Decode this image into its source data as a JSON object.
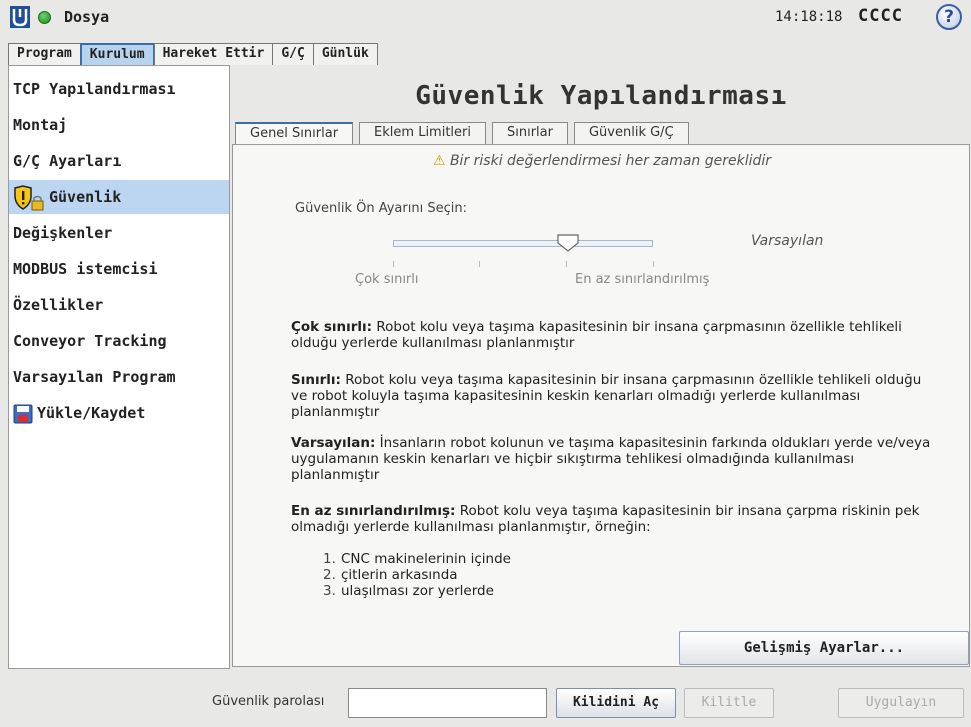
{
  "header": {
    "app_title": "Dosya",
    "clock": "14:18:18",
    "robot_name": "CCCC",
    "help_label": "?"
  },
  "main_tabs": [
    {
      "label": "Program",
      "active": false
    },
    {
      "label": "Kurulum",
      "active": true
    },
    {
      "label": "Hareket Ettir",
      "active": false
    },
    {
      "label": "G/Ç",
      "active": false
    },
    {
      "label": "Günlük",
      "active": false
    }
  ],
  "sidebar": {
    "items": [
      {
        "label": "TCP Yapılandırması"
      },
      {
        "label": "Montaj"
      },
      {
        "label": "G/Ç Ayarları"
      },
      {
        "label": "Güvenlik",
        "icon": "shield-lock-icon",
        "active": true
      },
      {
        "label": "Değişkenler"
      },
      {
        "label": "MODBUS istemcisi"
      },
      {
        "label": "Özellikler"
      },
      {
        "label": "Conveyor Tracking"
      },
      {
        "label": "Varsayılan Program"
      },
      {
        "label": "Yükle/Kaydet",
        "icon": "floppy-disk-icon"
      }
    ]
  },
  "content": {
    "title": "Güvenlik Yapılandırması",
    "sub_tabs": [
      {
        "label": "Genel Sınırlar",
        "active": true
      },
      {
        "label": "Eklem Limitleri",
        "active": false
      },
      {
        "label": "Sınırlar",
        "active": false
      },
      {
        "label": "Güvenlik G/Ç",
        "active": false
      }
    ],
    "warning": "Bir riski değerlendirmesi her zaman gereklidir",
    "preset": {
      "label": "Güvenlik Ön Ayarını Seçin:",
      "value": "Varsayılan",
      "min_label": "Çok sınırlı",
      "max_label": "En az sınırlandırılmış"
    },
    "descriptions": [
      {
        "term": "Çok sınırlı:",
        "text": " Robot kolu veya taşıma kapasitesinin bir insana çarpmasının özellikle tehlikeli olduğu yerlerde kullanılması planlanmıştır"
      },
      {
        "term": "Sınırlı:",
        "text": " Robot kolu veya taşıma kapasitesinin bir insana çarpmasının özellikle tehlikeli olduğu ve robot koluyla taşıma kapasitesinin keskin kenarları olmadığı yerlerde kullanılması planlanmıştır"
      },
      {
        "term": "Varsayılan:",
        "text": " İnsanların robot kolunun ve taşıma kapasitesinin farkında oldukları yerde ve/veya uygulamanın keskin kenarları ve hiçbir sıkıştırma tehlikesi olmadığında kullanılması planlanmıştır"
      },
      {
        "term": "En az sınırlandırılmış:",
        "text": " Robot kolu veya taşıma kapasitesinin bir insana çarpma riskinin pek olmadığı yerlerde kullanılması planlanmıştır, örneğin:"
      }
    ],
    "examples": [
      {
        "num": "1.",
        "text": "CNC makinelerinin içinde"
      },
      {
        "num": "2.",
        "text": "çitlerin arkasında"
      },
      {
        "num": "3.",
        "text": "ulaşılması zor yerlerde"
      }
    ],
    "advanced_button": "Gelişmiş Ayarlar..."
  },
  "footer": {
    "password_label": "Güvenlik parolası",
    "password_value": "",
    "unlock_button": "Kilidini Aç",
    "lock_button": "Kilitle",
    "apply_button": "Uygulayın"
  }
}
